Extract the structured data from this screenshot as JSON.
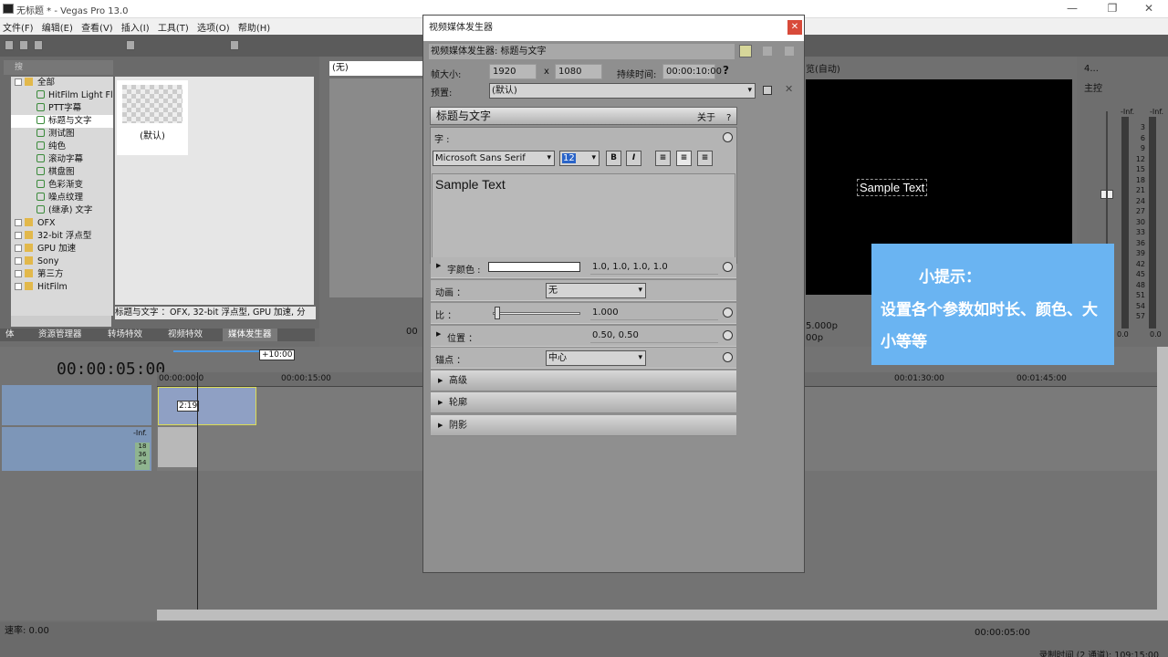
{
  "window": {
    "title": "无标题 * - Vegas Pro 13.0"
  },
  "menu": [
    "文件(F)",
    "编辑(E)",
    "查看(V)",
    "插入(I)",
    "工具(T)",
    "选项(O)",
    "帮助(H)"
  ],
  "explorer": {
    "search_placeholder": "搜",
    "tree": [
      {
        "label": "全部",
        "level": 0
      },
      {
        "label": "HitFilm Light Flar",
        "level": 1
      },
      {
        "label": "PTT字幕",
        "level": 1
      },
      {
        "label": "标题与文字",
        "level": 1,
        "selected": true
      },
      {
        "label": "测试图",
        "level": 1
      },
      {
        "label": "纯色",
        "level": 1
      },
      {
        "label": "滚动字幕",
        "level": 1
      },
      {
        "label": "棋盘图",
        "level": 1
      },
      {
        "label": "色彩渐变",
        "level": 1
      },
      {
        "label": "噪点纹理",
        "level": 1
      },
      {
        "label": "(继承) 文字",
        "level": 1
      },
      {
        "label": "OFX",
        "level": 0
      },
      {
        "label": "32-bit 浮点型",
        "level": 0
      },
      {
        "label": "GPU 加速",
        "level": 0
      },
      {
        "label": "Sony",
        "level": 0
      },
      {
        "label": "第三方",
        "level": 0
      },
      {
        "label": "HitFilm",
        "level": 0
      }
    ],
    "preset_label": "(默认)",
    "info": "标题与文字   ：OFX, 32-bit 浮点型, GPU 加速, 分",
    "tabs": [
      "体",
      "资源管理器",
      "转场特效",
      "视频特效",
      "媒体发生器"
    ]
  },
  "trimmer": {
    "none_label": "(无)",
    "time": "00"
  },
  "dialog": {
    "title": "视频媒体发生器",
    "header": "视频媒体发生器: 标题与文字",
    "size_label": "帧大小:",
    "width": "1920",
    "x": "x",
    "height": "1080",
    "duration_label": "持续时间:",
    "duration": "00:00:10:00",
    "help": "?",
    "preset_label": "预置:",
    "preset_value": "(默认)",
    "section_title": "标题与文字",
    "about": "关于",
    "about_help": "?",
    "font_label": "字 :",
    "font_name": "Microsoft Sans Serif",
    "font_size": "12",
    "bold": "B",
    "italic": "I",
    "sample_text": "Sample Text",
    "text_color_label": "字颜色 :",
    "text_color_value": "1.0, 1.0, 1.0, 1.0",
    "animation_label": "动画  ：",
    "animation_value": "无",
    "scale_label": "比 ：",
    "scale_value": "1.000",
    "position_label": "位置 ：",
    "position_value": "0.50, 0.50",
    "anchor_label": "锚点  ：",
    "anchor_value": "中心",
    "advanced": "高级",
    "outline": "轮廓",
    "shadow": "阴影"
  },
  "preview": {
    "mode": "览(自动)",
    "sample_text": "Sample Text",
    "info1": "5.000p",
    "info2": "00p"
  },
  "tip": {
    "line1": "小提示：",
    "line2": "设置各个参数如时长、颜色、大小等等"
  },
  "mixer": {
    "title": "主控",
    "count": "4...",
    "left_db": "-Inf.",
    "right_db": "-Inf.",
    "scale": [
      "3",
      "6",
      "9",
      "12",
      "15",
      "18",
      "21",
      "24",
      "27",
      "30",
      "33",
      "36",
      "39",
      "42",
      "45",
      "48",
      "51",
      "54",
      "57"
    ],
    "bottom_left": "0.0",
    "bottom_right": "0.0"
  },
  "timeline": {
    "current_time": "00:00:05:00",
    "plus": "+10:00",
    "ruler": [
      "00:00:00:0",
      "00:00:15:00",
      "00:01:30:00",
      "00:01:45:00"
    ],
    "clip_label": "2:19",
    "audio_db": "-Inf.",
    "audio_nums": [
      "18",
      "36",
      "54"
    ],
    "rate": "速率: 0.00",
    "cursor_time": "00:00:05:00",
    "status": "录制时间 (2 通道): 109:15:00"
  }
}
